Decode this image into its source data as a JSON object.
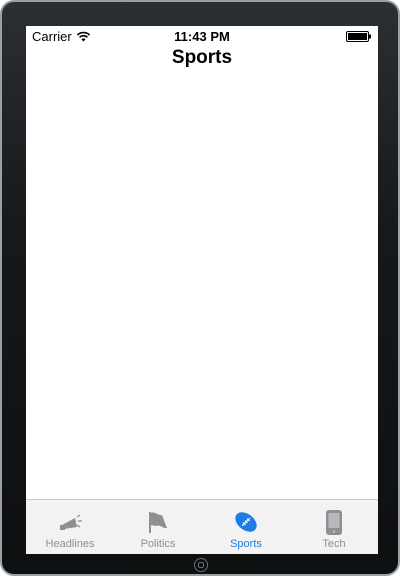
{
  "status_bar": {
    "carrier": "Carrier",
    "time": "11:43 PM",
    "wifi_icon": "wifi-icon",
    "battery_icon": "battery-icon"
  },
  "nav_bar": {
    "title": "Sports"
  },
  "tab_bar": {
    "selected_tab": "Sports",
    "selected_color": "#1d7ce5",
    "unselected_color": "#8e8e93",
    "tabs": [
      {
        "label": "Headlines",
        "icon": "megaphone-icon"
      },
      {
        "label": "Politics",
        "icon": "flag-icon"
      },
      {
        "label": "Sports",
        "icon": "football-icon"
      },
      {
        "label": "Tech",
        "icon": "phone-device-icon"
      }
    ]
  }
}
